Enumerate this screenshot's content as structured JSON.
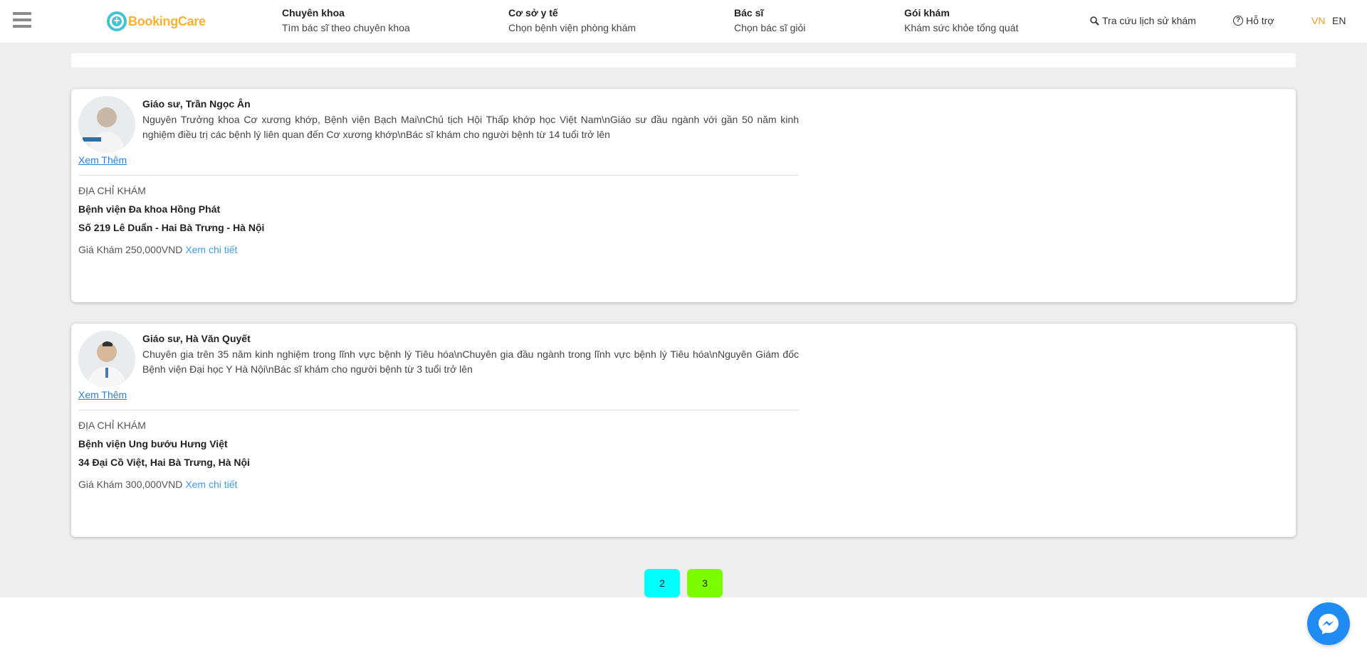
{
  "header": {
    "logo_text": "BookingCare",
    "nav": [
      {
        "title": "Chuyên khoa",
        "subtitle": "Tìm bác sĩ theo chuyên khoa"
      },
      {
        "title": "Cơ sở y tế",
        "subtitle": "Chọn bệnh viện phòng khám"
      },
      {
        "title": "Bác sĩ",
        "subtitle": "Chọn bác sĩ giỏi"
      },
      {
        "title": "Gói khám",
        "subtitle": "Khám sức khỏe tổng quát"
      }
    ],
    "lookup_label": "Tra cứu lịch sử khám",
    "support_label": "Hỗ trợ",
    "lang_vn": "VN",
    "lang_en": "EN"
  },
  "colors": {
    "brand_orange": "#f7b32b",
    "brand_teal": "#45c3d2",
    "lang_active": "#f29a1f",
    "link_blue": "#3d9be9",
    "page_2_bg": "#00ffff",
    "page_3_bg": "#7cfc00",
    "messenger": "#1f8bf3"
  },
  "doctors": [
    {
      "name": "Giáo sư, Trần Ngọc Ân",
      "description": "Nguyên Trưởng khoa Cơ xương khớp, Bệnh viện Bạch Mai\\nChủ tịch Hội Thấp khớp học Việt Nam\\nGiáo sư đầu ngành với gần 50 năm kinh nghiệm điều trị các bệnh lý liên quan đến Cơ xương khớp\\nBác sĩ khám cho người bệnh từ 14 tuổi trở lên",
      "more_label": "Xem Thêm",
      "address_label": "ĐỊA CHỈ KHÁM",
      "clinic": "Bệnh viện Đa khoa Hồng Phát",
      "address": "Số 219 Lê Duẩn - Hai Bà Trưng - Hà Nội",
      "price_label": "Giá Khám 250,000VND",
      "detail_label": "Xem chi tiết"
    },
    {
      "name": "Giáo sư, Hà Văn Quyết",
      "description": "Chuyên gia trên 35 năm kinh nghiệm trong lĩnh vực bệnh lý Tiêu hóa\\nChuyên gia đầu ngành trong lĩnh vực bệnh lý Tiêu hóa\\nNguyên Giám đốc Bệnh viện Đại học Y Hà Nội\\nBác sĩ khám cho người bệnh từ 3 tuổi trở lên",
      "more_label": "Xem Thêm",
      "address_label": "ĐỊA CHỈ KHÁM",
      "clinic": "Bệnh viện Ung bướu Hưng Việt",
      "address": "34 Đại Cồ Việt, Hai Bà Trưng, Hà Nội",
      "price_label": "Giá Khám 300,000VND",
      "detail_label": "Xem chi tiết"
    }
  ],
  "pagination": [
    "2",
    "3"
  ],
  "icons": {
    "menu": "hamburger-icon",
    "lookup": "search-icon",
    "support": "help-circle-icon",
    "chat": "messenger-icon"
  }
}
